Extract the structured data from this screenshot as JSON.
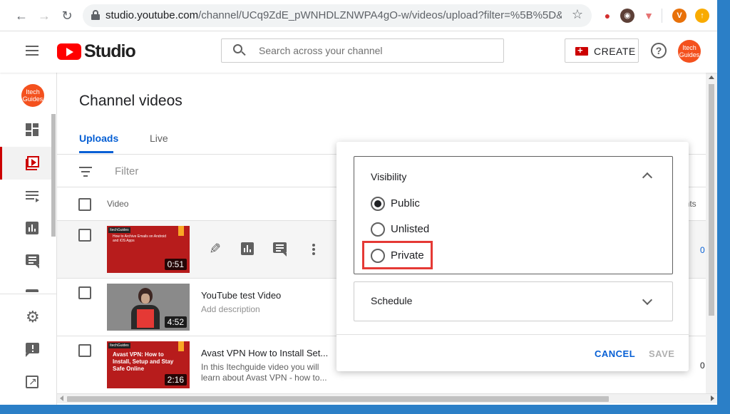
{
  "browser": {
    "url_main": "studio.youtube.com",
    "url_rest": "/channel/UCq9ZdE_pWNHDLZNWPA4gO-w/videos/upload?filter=%5B%5D&sort=%7...",
    "profile_initial": "V"
  },
  "header": {
    "logo_text": "Studio",
    "search_placeholder": "Search across your channel",
    "create_label": "CREATE",
    "help_label": "?",
    "avatar_text": "Itech Guides"
  },
  "sidebar": {
    "avatar_text": "Itech Guides"
  },
  "main": {
    "title": "Channel videos",
    "tabs": [
      {
        "label": "Uploads"
      },
      {
        "label": "Live"
      }
    ],
    "filter_placeholder": "Filter",
    "columns": {
      "video": "Video",
      "comments_partial": "ents"
    },
    "rows": [
      {
        "thumb_badge": "ItechGuides",
        "thumb_title": "How to Archive Emails on Android and iOS Apps",
        "duration": "0:51",
        "trailing": "0"
      },
      {
        "title": "YouTube test Video",
        "description": "Add description",
        "duration": "4:52"
      },
      {
        "thumb_badge": "ItechGuides",
        "thumb_title": "Avast VPN: How to Install, Setup and Stay Safe Online",
        "title": "Avast VPN How to Install Set...",
        "description": "In this Itechguide video you will learn about Avast VPN - how to...",
        "duration": "2:16",
        "trailing": "0"
      }
    ]
  },
  "popup": {
    "visibility_title": "Visibility",
    "options": [
      {
        "label": "Public",
        "checked": true
      },
      {
        "label": "Unlisted",
        "checked": false
      },
      {
        "label": "Private",
        "checked": false
      }
    ],
    "schedule_title": "Schedule",
    "cancel_label": "CANCEL",
    "save_label": "SAVE"
  },
  "colors": {
    "accent_blue": "#065fd4",
    "brand_red": "#ff0000",
    "highlight_red": "#e53935",
    "avatar_orange": "#f4511e"
  }
}
